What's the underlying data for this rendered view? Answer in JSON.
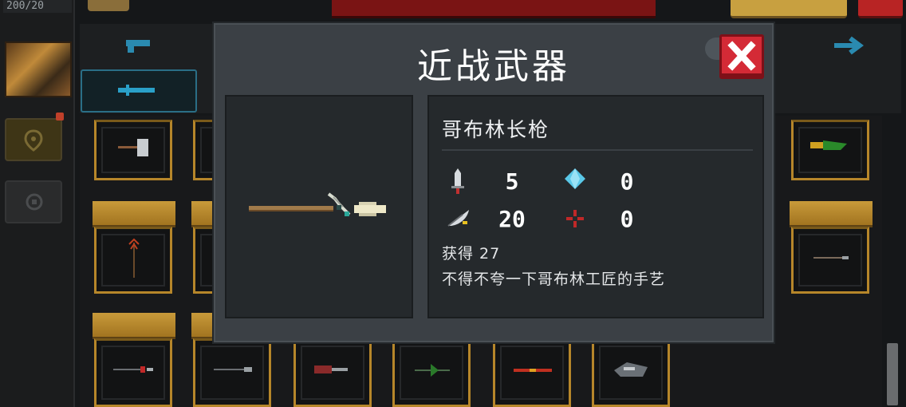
{
  "top_bar": {
    "counter_text": "200/20"
  },
  "modal": {
    "title": "近战武器",
    "weapon": {
      "name": "哥布林长枪",
      "stats": {
        "damage": "5",
        "energy": "0",
        "critical": "20",
        "accuracy": "0"
      },
      "acquired_line": "获得 27",
      "description": "不得不夸一下哥布林工匠的手艺"
    }
  },
  "colors": {
    "accent_red": "#d42a36",
    "frame_gold": "#b6862a",
    "panel_bg": "#25292c",
    "modal_bg": "#3b4045",
    "tab_highlight": "#2a6e86"
  },
  "icons": {
    "close": "close-x-icon",
    "damage": "sword-icon",
    "energy": "diamond-icon",
    "critical": "feather-icon",
    "accuracy": "crosshair-icon"
  }
}
